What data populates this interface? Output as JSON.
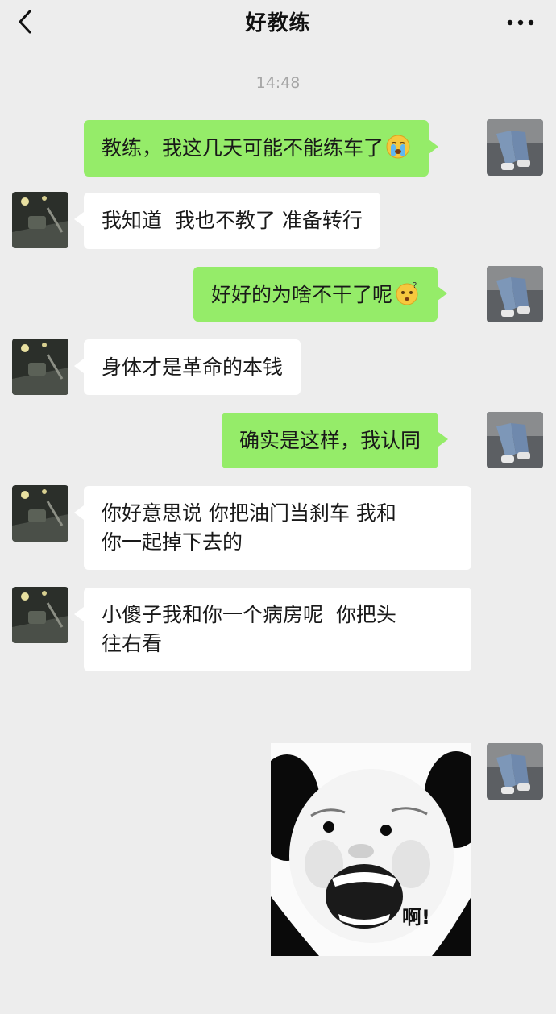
{
  "header": {
    "back_icon": "chevron-left-icon",
    "title": "好教练",
    "more_icon": "more-dots-icon"
  },
  "timestamp": "14:48",
  "messages": [
    {
      "from": "me",
      "text": "教练，我这几天可能不能练车了",
      "emoji": "crying-face"
    },
    {
      "from": "coach",
      "text": "我知道  我也不教了 准备转行"
    },
    {
      "from": "me",
      "text": "好好的为啥不干了呢",
      "emoji": "confused-face"
    },
    {
      "from": "coach",
      "text": "身体才是革命的本钱"
    },
    {
      "from": "me",
      "text": "确实是这样，我认同"
    },
    {
      "from": "coach",
      "line1": "你好意思说 你把油门当刹车 我和",
      "line2": "你一起掉下去的"
    },
    {
      "from": "coach",
      "line1": "小傻子我和你一个病房呢  你把头",
      "line2": "往右看"
    },
    {
      "from": "me",
      "sticker": "panda-meme-sticker",
      "sticker_text": "啊!"
    }
  ],
  "colors": {
    "background": "#ededed",
    "outgoing_bubble": "#95ec69",
    "incoming_bubble": "#ffffff"
  }
}
